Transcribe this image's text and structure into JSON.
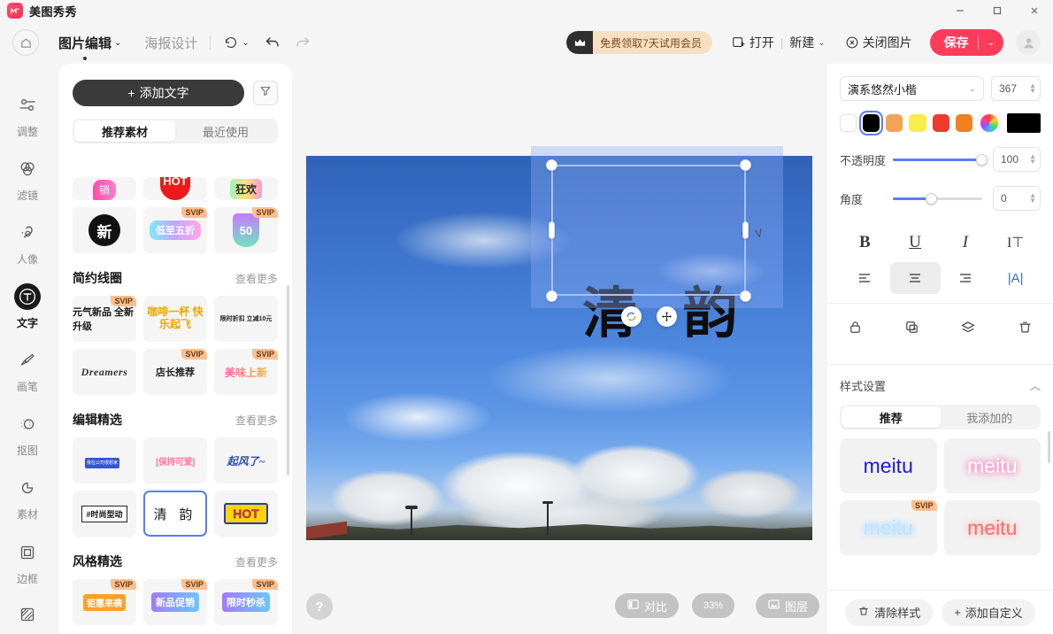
{
  "window": {
    "app_name": "美图秀秀",
    "controls": {
      "minimize": "—",
      "maximize": "□",
      "close": "✕"
    }
  },
  "toolbar": {
    "home_icon": "home-icon",
    "primary_menu": "图片编辑",
    "secondary_menu": "海报设计",
    "history_icon": "history-icon",
    "undo_icon": "undo-icon",
    "redo_icon": "redo-icon",
    "vip_banner": "免费领取7天试用会员",
    "open_label": "打开",
    "separator": "|",
    "new_label": "新建",
    "close_image_label": "关闭图片",
    "save_label": "保存",
    "avatar": "user-avatar"
  },
  "sidebar": {
    "items": [
      {
        "label": "调整",
        "icon": "sliders-icon",
        "active": false
      },
      {
        "label": "滤镜",
        "icon": "filter-circles-icon",
        "active": false
      },
      {
        "label": "人像",
        "icon": "portrait-icon",
        "active": false
      },
      {
        "label": "文字",
        "icon": "text-icon",
        "active": true
      },
      {
        "label": "画笔",
        "icon": "brush-icon",
        "active": false
      },
      {
        "label": "抠图",
        "icon": "cutout-icon",
        "active": false
      },
      {
        "label": "素材",
        "icon": "sticker-icon",
        "active": false
      },
      {
        "label": "边框",
        "icon": "frame-icon",
        "active": false
      },
      {
        "label": "",
        "icon": "texture-icon",
        "active": false
      }
    ]
  },
  "material_panel": {
    "add_text_button": "添加文字",
    "filter_icon": "funnel-icon",
    "tabs": [
      {
        "label": "推荐素材",
        "active": true
      },
      {
        "label": "最近使用",
        "active": false
      }
    ],
    "see_more": "查看更多",
    "svip_badge": "SVIP",
    "rows_top": [
      {
        "art": "pink-bubble",
        "text": "销",
        "svip": false
      },
      {
        "art": "red-circle",
        "text": "HOT",
        "svip": false
      },
      {
        "art": "rainbow",
        "text": "狂欢",
        "svip": false
      },
      {
        "art": "black-circle",
        "text": "新",
        "svip": false
      },
      {
        "art": "grad-pill",
        "text": "低至五折",
        "svip": true
      },
      {
        "art": "shield",
        "text": "50",
        "svip": true
      }
    ],
    "sections": [
      {
        "title": "简约线圈",
        "items": [
          {
            "art": "green-underline",
            "text": "元气新品 全新升级",
            "svip": true
          },
          {
            "art": "yellow-star",
            "text": "咖啡一杯 快乐起飞",
            "svip": false
          },
          {
            "art": "mini-line",
            "text": "限时折扣 立减10元",
            "svip": false
          },
          {
            "art": "dreamers",
            "text": "Dreamers",
            "svip": false
          },
          {
            "art": "store",
            "text": "店长推荐",
            "svip": true
          },
          {
            "art": "meiwei",
            "text": "美味上新",
            "svip": true
          }
        ]
      },
      {
        "title": "编辑精选",
        "items": [
          {
            "art": "signboard",
            "text": "我在公司很想家",
            "svip": false
          },
          {
            "art": "pink-bracket",
            "text": "[保持可爱]",
            "svip": false
          },
          {
            "art": "blue-italic",
            "text": "起风了~",
            "svip": false
          },
          {
            "art": "hashtag",
            "text": "#时尚型动",
            "svip": false
          },
          {
            "art": "qingyun",
            "text": "清 韵",
            "svip": false,
            "selected": true
          },
          {
            "art": "hot-badge",
            "text": "HOT",
            "svip": false
          }
        ]
      },
      {
        "title": "风格精选",
        "items": [
          {
            "art": "purple-hand",
            "text": "钜惠来袭",
            "svip": true
          },
          {
            "art": "gift-box",
            "text": "新品促销",
            "svip": true
          },
          {
            "art": "alarm-clock",
            "text": "限时秒杀",
            "svip": true
          }
        ]
      }
    ]
  },
  "canvas": {
    "text_layer": "清 韵",
    "rotate_handle_icon": "rotate-icon",
    "move_handle_icon": "move-icon",
    "bottom_bar": {
      "help": "?",
      "compare_label": "对比",
      "compare_icon": "compare-icon",
      "zoom_level": "33%",
      "layers_label": "图层",
      "layers_icon": "layers-icon"
    }
  },
  "right_panel": {
    "font_name": "演系悠然小楷",
    "font_size": "367",
    "colors": {
      "swatches": [
        "#ffffff",
        "#000000",
        "#f4a356",
        "#f9ec4b",
        "#ee3b2b",
        "#f08020"
      ],
      "selected_index": 1,
      "wheel_icon": "color-wheel-icon",
      "current": "#000000"
    },
    "opacity": {
      "label": "不透明度",
      "value": "100",
      "percent": 100
    },
    "angle": {
      "label": "角度",
      "value": "0",
      "percent": 44
    },
    "format_buttons": [
      {
        "name": "bold",
        "glyph": "B",
        "active": false
      },
      {
        "name": "underline",
        "glyph": "U",
        "active": false
      },
      {
        "name": "italic",
        "glyph": "I",
        "active": false
      },
      {
        "name": "line-height",
        "glyph": "I⊤",
        "active": false
      }
    ],
    "align_buttons": [
      {
        "name": "align-left",
        "active": false
      },
      {
        "name": "align-center",
        "active": true
      },
      {
        "name": "align-right",
        "active": false
      },
      {
        "name": "text-direction",
        "glyph": "|A|",
        "active": false
      }
    ],
    "action_buttons": [
      {
        "name": "lock",
        "icon": "lock-icon"
      },
      {
        "name": "duplicate",
        "icon": "copy-plus-icon"
      },
      {
        "name": "layers",
        "icon": "layers-icon"
      },
      {
        "name": "delete",
        "icon": "trash-icon"
      }
    ],
    "style_section": {
      "title": "样式设置",
      "collapse_icon": "chevron-up-icon",
      "tabs": [
        {
          "label": "推荐",
          "active": true
        },
        {
          "label": "我添加的",
          "active": false
        }
      ],
      "presets": [
        {
          "text": "meitu",
          "style": "blue-solid",
          "svip": false
        },
        {
          "text": "meitu",
          "style": "pink-glow",
          "svip": false
        },
        {
          "text": "meitu",
          "style": "ice-blue-glow",
          "svip": true
        },
        {
          "text": "meitu",
          "style": "red-glow",
          "svip": false
        }
      ],
      "svip_badge": "SVIP"
    },
    "footer": {
      "clear_style": "清除样式",
      "clear_icon": "trash-icon",
      "add_custom": "添加自定义",
      "add_icon": "plus-icon"
    }
  }
}
